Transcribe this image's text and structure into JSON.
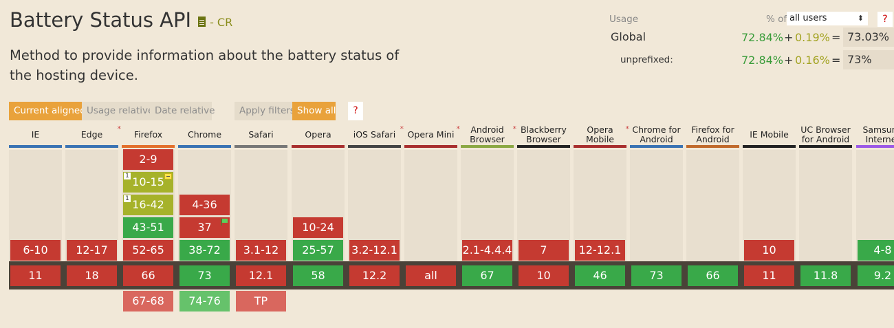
{
  "page": {
    "title": "Battery Status API",
    "status": "- CR",
    "description": "Method to provide information about the battery status of the hosting device."
  },
  "usage": {
    "label": "Usage",
    "pct_of": "% of",
    "selector_value": "all users",
    "help": "?",
    "global": {
      "label": "Global",
      "supported": "72.84%",
      "plus": "+",
      "partial": "0.19%",
      "eq": "=",
      "total": "73.03%"
    },
    "unprefixed": {
      "label": "unprefixed:",
      "supported": "72.84%",
      "plus": "+",
      "partial": "0.16%",
      "eq": "=",
      "total": "73%"
    }
  },
  "filters": {
    "current_aligned": "Current aligned",
    "usage_relative": "Usage relative",
    "date_relative": "Date relative",
    "apply_filters": "Apply filters",
    "show_all": "Show all",
    "help": "?"
  },
  "colors": {
    "supported": "#39a949",
    "unsupported": "#c53a31",
    "partial": "#a6b22a"
  },
  "browsers": [
    {
      "name": "IE",
      "bar": "#3a73b3",
      "star": false,
      "cells": [
        {
          "v": "6-10",
          "s": "r"
        }
      ],
      "current": {
        "v": "11",
        "s": "r"
      },
      "future": []
    },
    {
      "name": "Edge",
      "bar": "#3a73b3",
      "star": true,
      "cells": [
        {
          "v": "12-17",
          "s": "r"
        }
      ],
      "current": {
        "v": "18",
        "s": "r"
      },
      "future": []
    },
    {
      "name": "Firefox",
      "bar": "#e36f2b",
      "star": false,
      "cells": [
        {
          "v": "2-9",
          "s": "r"
        },
        {
          "v": "10-15",
          "s": "y",
          "note": "1",
          "prefix": true
        },
        {
          "v": "16-42",
          "s": "y",
          "note": "1"
        },
        {
          "v": "43-51",
          "s": "g"
        },
        {
          "v": "52-65",
          "s": "r"
        }
      ],
      "current": {
        "v": "66",
        "s": "r"
      },
      "future": [
        {
          "v": "67-68",
          "s": "rl"
        }
      ]
    },
    {
      "name": "Chrome",
      "bar": "#3a73b3",
      "star": false,
      "cells": [
        {
          "v": "4-36",
          "s": "r"
        },
        {
          "v": "37",
          "s": "r",
          "flag": true
        },
        {
          "v": "38-72",
          "s": "g"
        }
      ],
      "current": {
        "v": "73",
        "s": "g"
      },
      "future": [
        {
          "v": "74-76",
          "s": "gl"
        }
      ]
    },
    {
      "name": "Safari",
      "bar": "#777777",
      "star": false,
      "cells": [
        {
          "v": "3.1-12",
          "s": "r"
        }
      ],
      "current": {
        "v": "12.1",
        "s": "r"
      },
      "future": [
        {
          "v": "TP",
          "s": "rl"
        }
      ]
    },
    {
      "name": "Opera",
      "bar": "#a82e2e",
      "star": false,
      "cells": [
        {
          "v": "10-24",
          "s": "r"
        },
        {
          "v": "25-57",
          "s": "g"
        }
      ],
      "current": {
        "v": "58",
        "s": "g"
      },
      "future": []
    },
    {
      "name": "iOS Safari",
      "bar": "#444444",
      "star": true,
      "cells": [
        {
          "v": "3.2-12.1",
          "s": "r"
        }
      ],
      "current": {
        "v": "12.2",
        "s": "r"
      },
      "future": []
    },
    {
      "name": "Opera Mini",
      "bar": "#a82e2e",
      "star": true,
      "cells": [],
      "current": {
        "v": "all",
        "s": "r"
      },
      "future": []
    },
    {
      "name": "Android Browser",
      "bar": "#8ba843",
      "star": true,
      "cells": [
        {
          "v": "2.1-4.4.4",
          "s": "r"
        }
      ],
      "current": {
        "v": "67",
        "s": "g"
      },
      "future": []
    },
    {
      "name": "Blackberry Browser",
      "bar": "#222222",
      "star": false,
      "cells": [
        {
          "v": "7",
          "s": "r"
        }
      ],
      "current": {
        "v": "10",
        "s": "r"
      },
      "future": []
    },
    {
      "name": "Opera Mobile",
      "bar": "#a82e2e",
      "star": true,
      "cells": [
        {
          "v": "12-12.1",
          "s": "r"
        }
      ],
      "current": {
        "v": "46",
        "s": "g"
      },
      "future": []
    },
    {
      "name": "Chrome for Android",
      "bar": "#3a73b3",
      "star": false,
      "cells": [],
      "current": {
        "v": "73",
        "s": "g"
      },
      "future": []
    },
    {
      "name": "Firefox for Android",
      "bar": "#c0692b",
      "star": false,
      "cells": [],
      "current": {
        "v": "66",
        "s": "g"
      },
      "future": []
    },
    {
      "name": "IE Mobile",
      "bar": "#222222",
      "star": false,
      "cells": [
        {
          "v": "10",
          "s": "r"
        }
      ],
      "current": {
        "v": "11",
        "s": "r"
      },
      "future": []
    },
    {
      "name": "UC Browser for Android",
      "bar": "#222222",
      "star": false,
      "cells": [],
      "current": {
        "v": "11.8",
        "s": "g"
      },
      "future": []
    },
    {
      "name": "Samsung Internet",
      "bar": "#9b59e6",
      "star": false,
      "cells": [
        {
          "v": "4-8",
          "s": "g"
        }
      ],
      "current": {
        "v": "9.2",
        "s": "g"
      },
      "future": []
    }
  ]
}
